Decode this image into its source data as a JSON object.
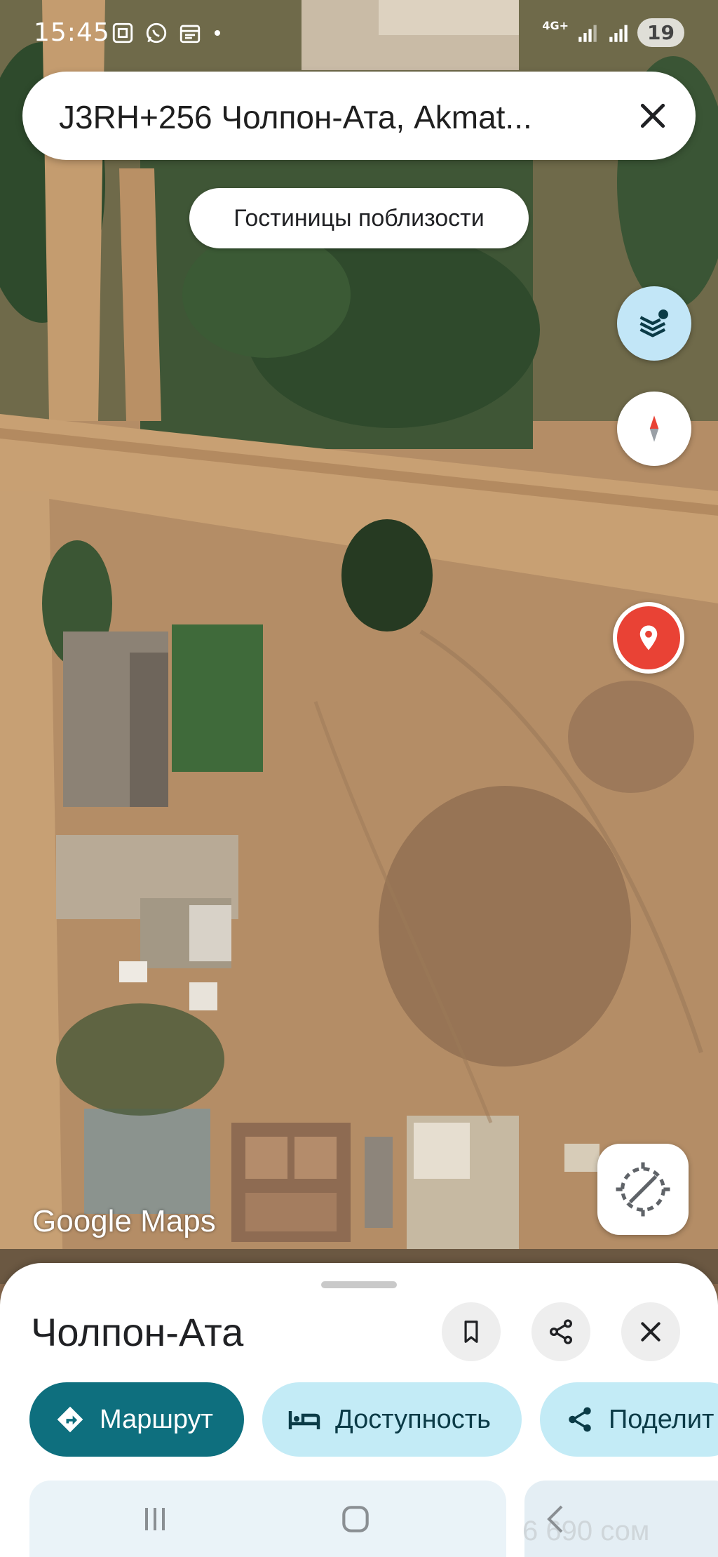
{
  "status_bar": {
    "time": "15:45",
    "network": "4G+",
    "battery": "19",
    "icons": [
      "screenshot-icon",
      "whatsapp-icon",
      "calendar-icon",
      "dot-icon",
      "signal-icon",
      "signal-icon-2"
    ]
  },
  "search": {
    "query": "J3RH+256 Чолпон-Ата, Akmat...",
    "clear_icon": "close-icon"
  },
  "map": {
    "nearby_chip": "Гостиницы поблизости",
    "watermark": "Google Maps",
    "layers_icon": "layers-icon",
    "compass_icon": "compass-icon",
    "pin_icon": "location-pin-icon",
    "my_location_icon": "my-location-icon"
  },
  "sheet": {
    "title": "Чолпон-Ата",
    "save_icon": "bookmark-icon",
    "share_icon": "share-icon",
    "close_icon": "close-icon",
    "chips": [
      {
        "label": "Маршрут",
        "icon": "directions-icon"
      },
      {
        "label": "Доступность",
        "icon": "bed-icon"
      },
      {
        "label": "Поделит",
        "icon": "share-icon"
      }
    ],
    "price": "6 690 сом"
  },
  "colors": {
    "route_chip": "#0e6f7e",
    "light_chip": "#c3ebf6",
    "pin": "#e94235",
    "layers_btn": "#c2e6f7"
  }
}
